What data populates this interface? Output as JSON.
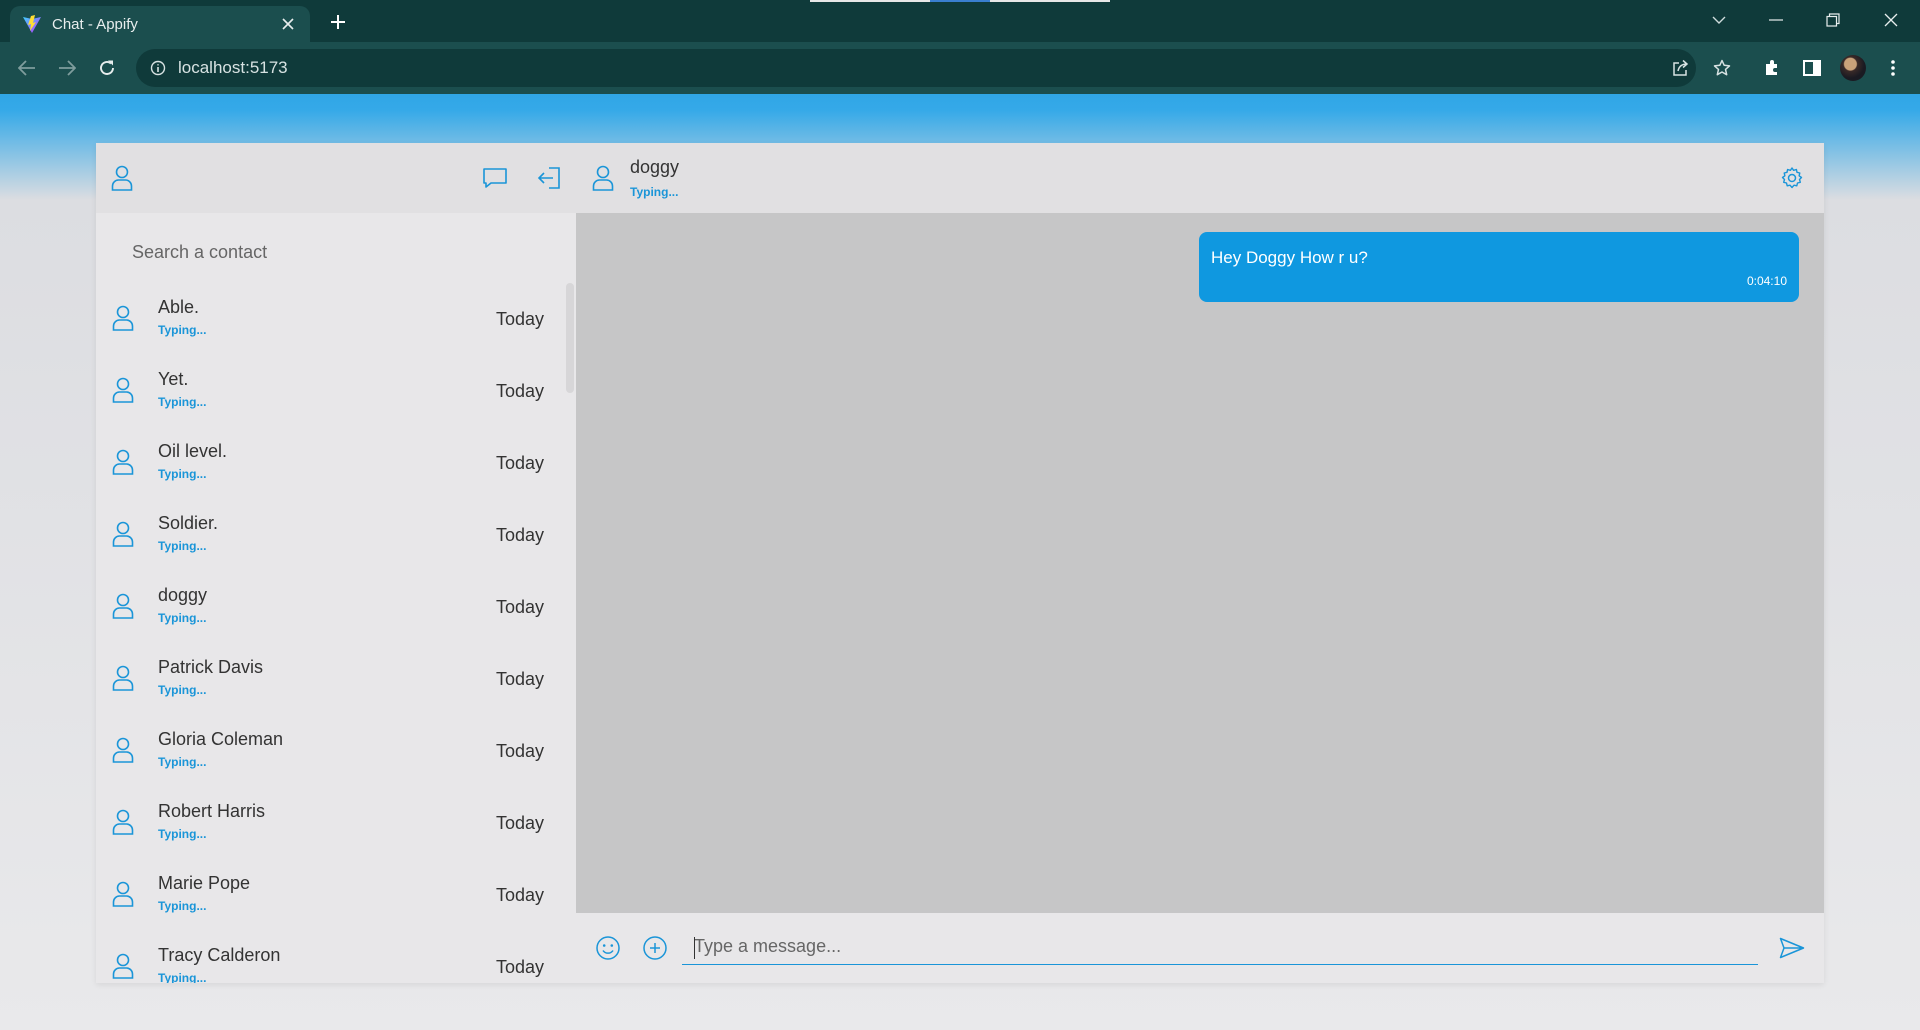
{
  "browser": {
    "tab_title": "Chat - Appify",
    "url": "localhost:5173",
    "icons": [
      "vite-favicon",
      "close-icon",
      "plus-icon",
      "chevron-down-icon",
      "minimize-icon",
      "restore-icon",
      "window-close-icon",
      "back-icon",
      "forward-icon",
      "reload-icon",
      "info-icon",
      "share-icon",
      "star-icon",
      "extensions-icon",
      "side-panel-icon",
      "profile-avatar",
      "kebab-menu-icon"
    ]
  },
  "sidebar": {
    "search_placeholder": "Search a contact",
    "contacts": [
      {
        "name": "Able.",
        "status": "Typing...",
        "time": "Today"
      },
      {
        "name": "Yet.",
        "status": "Typing...",
        "time": "Today"
      },
      {
        "name": "Oil level.",
        "status": "Typing...",
        "time": "Today"
      },
      {
        "name": "Soldier.",
        "status": "Typing...",
        "time": "Today"
      },
      {
        "name": "doggy",
        "status": "Typing...",
        "time": "Today"
      },
      {
        "name": "Patrick Davis",
        "status": "Typing...",
        "time": "Today"
      },
      {
        "name": "Gloria Coleman",
        "status": "Typing...",
        "time": "Today"
      },
      {
        "name": "Robert Harris",
        "status": "Typing...",
        "time": "Today"
      },
      {
        "name": "Marie Pope",
        "status": "Typing...",
        "time": "Today"
      },
      {
        "name": "Tracy Calderon",
        "status": "Typing...",
        "time": "Today"
      }
    ]
  },
  "chat": {
    "contact_name": "doggy",
    "contact_status": "Typing...",
    "messages": [
      {
        "text": "Hey Doggy How r u?",
        "time": "0:04:10",
        "outgoing": true
      }
    ],
    "input_placeholder": "Type a message..."
  },
  "colors": {
    "accent": "#1a95d8",
    "bubble": "#0f98e0",
    "chrome_dark": "#0f3a3a",
    "chrome_toolbar": "#1b4e4e"
  }
}
